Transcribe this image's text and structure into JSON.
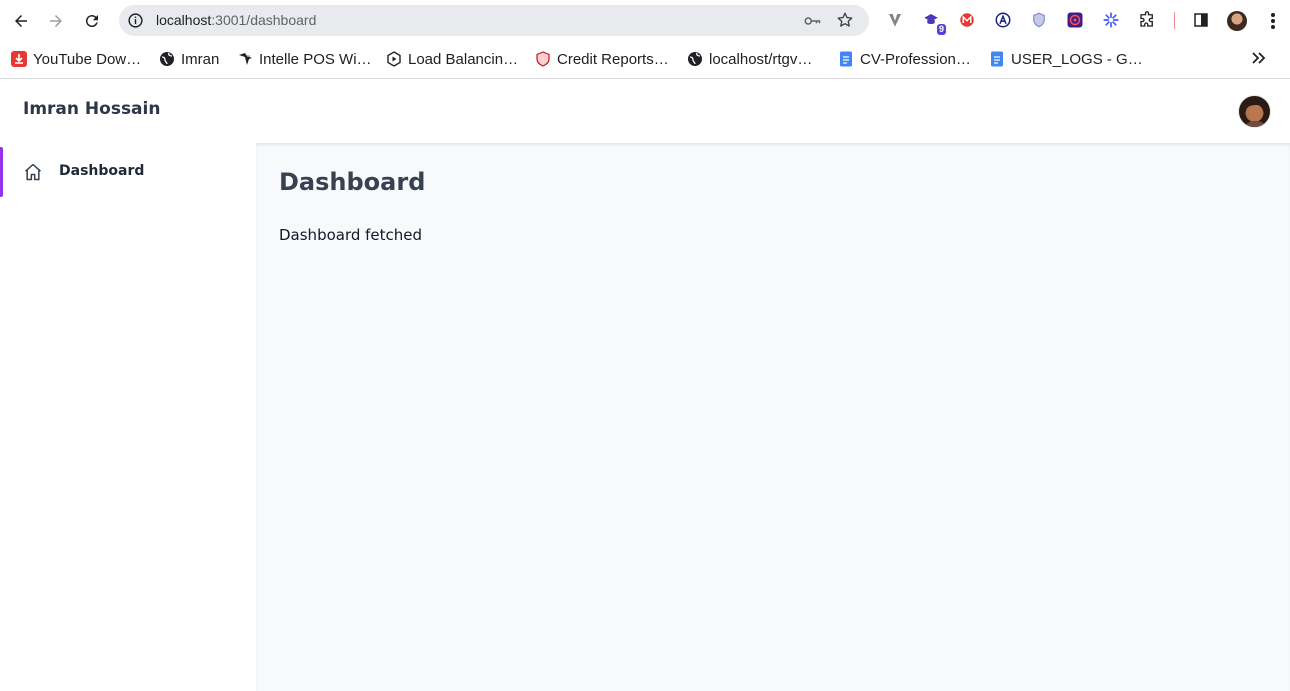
{
  "browser": {
    "url_host": "localhost",
    "url_path": ":3001/dashboard",
    "extensions": [
      "vimium-icon",
      "nine-badge-extension-icon",
      "m-extension-icon",
      "a-circle-extension-icon",
      "shield-extension-icon",
      "target-extension-icon",
      "snowflake-extension-icon",
      "puzzle-icon"
    ],
    "extension_badge": "9",
    "bookmarks": [
      {
        "label": "YouTube Dow…",
        "icon": "download-icon"
      },
      {
        "label": "Imran",
        "icon": "globe-icon"
      },
      {
        "label": "Intelle POS Wi…",
        "icon": "bird-icon"
      },
      {
        "label": "Load Balancin…",
        "icon": "hexagon-icon"
      },
      {
        "label": "Credit Reports…",
        "icon": "shield-icon"
      },
      {
        "label": "localhost/rtgv…",
        "icon": "globe-icon"
      },
      {
        "label": "CV-Profession…",
        "icon": "doc-icon"
      },
      {
        "label": "USER_LOGS - G…",
        "icon": "doc-icon"
      }
    ]
  },
  "app": {
    "brand": "Imran Hossain",
    "sidebar": {
      "items": [
        {
          "label": "Dashboard",
          "icon": "home-icon",
          "active": true
        }
      ]
    },
    "main": {
      "title": "Dashboard",
      "message": "Dashboard fetched"
    },
    "colors": {
      "accent": "#9333ea",
      "main_bg": "#f8f9fb"
    }
  }
}
